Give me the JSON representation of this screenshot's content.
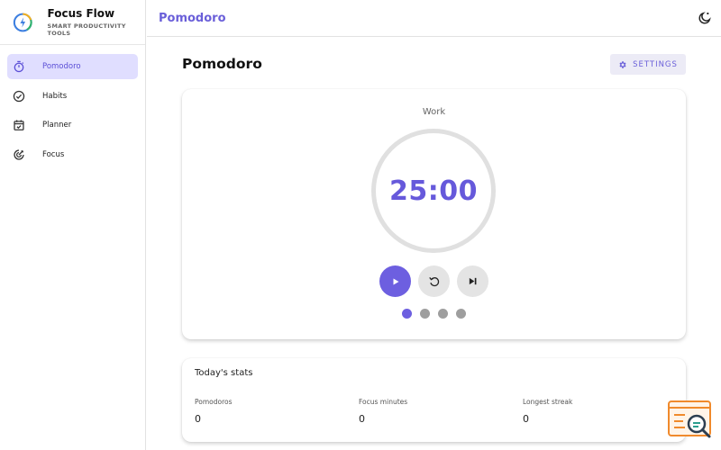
{
  "app": {
    "name": "Focus Flow",
    "tagline": "SMART PRODUCTIVITY TOOLS"
  },
  "sidebar": {
    "items": [
      {
        "label": "Pomodoro",
        "icon": "timer-icon",
        "active": true
      },
      {
        "label": "Habits",
        "icon": "check-circle-icon",
        "active": false
      },
      {
        "label": "Planner",
        "icon": "calendar-check-icon",
        "active": false
      },
      {
        "label": "Focus",
        "icon": "target-icon",
        "active": false
      }
    ]
  },
  "topbar": {
    "title": "Pomodoro",
    "theme_toggle_icon": "moon-icon"
  },
  "main": {
    "title": "Pomodoro",
    "settings_label": "SETTINGS",
    "timer": {
      "mode": "Work",
      "time": "25:00",
      "session_dots": 4,
      "active_dot": 0
    },
    "stats": {
      "title": "Today's stats",
      "items": [
        {
          "label": "Pomodoros",
          "value": "0"
        },
        {
          "label": "Focus minutes",
          "value": "0"
        },
        {
          "label": "Longest streak",
          "value": "0"
        }
      ]
    }
  },
  "colors": {
    "accent": "#6d5fe0",
    "accent_light": "#e0deff",
    "ring": "#e0e0e0"
  }
}
